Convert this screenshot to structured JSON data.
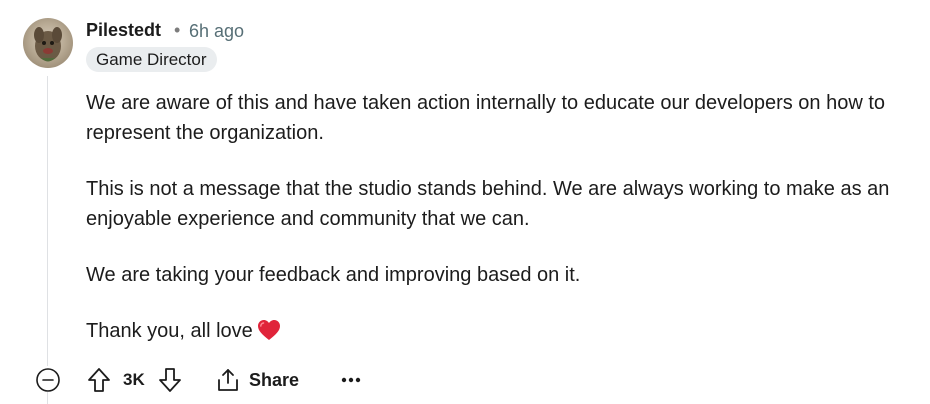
{
  "comment": {
    "author": "Pilestedt",
    "separator": "•",
    "timestamp": "6h ago",
    "flair": "Game Director",
    "paragraphs": [
      "We are aware of this and have taken action internally to educate our developers on how to represent the organization.",
      "This is not a message that the studio stands behind. We are always working to make as an enjoyable experience and community that we can.",
      "We are taking your feedback and improving based on it.",
      "Thank you, all love"
    ],
    "heart_icon": "red-heart-emoji"
  },
  "actions": {
    "collapse_icon": "minus-circle-icon",
    "upvote_icon": "arrow-up-icon",
    "vote_count": "3K",
    "downvote_icon": "arrow-down-icon",
    "share_icon": "share-icon",
    "share_label": "Share",
    "more_icon": "ellipsis-icon"
  },
  "colors": {
    "text": "#1c1c1c",
    "muted": "#576f76",
    "flair_bg": "#eaedef",
    "thread_line": "#dfe1e4",
    "heart": "#e0243a"
  }
}
